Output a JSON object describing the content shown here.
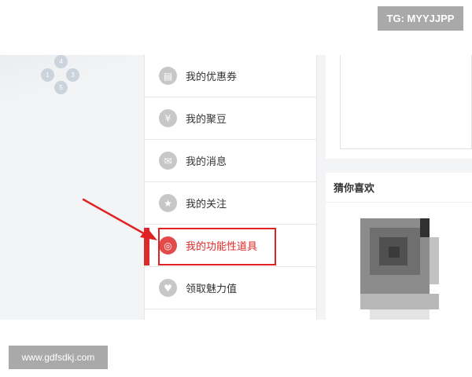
{
  "watermark_top": "TG: MYYJJPP",
  "watermark_bottom": "www.gdfsdkj.com",
  "dpad": {
    "labels": [
      "4",
      "1",
      "3",
      "5"
    ]
  },
  "menu": {
    "items": [
      {
        "label": "我的优惠券",
        "icon": "coupon-icon",
        "glyph": "▤"
      },
      {
        "label": "我的聚豆",
        "icon": "yen-icon",
        "glyph": "¥"
      },
      {
        "label": "我的消息",
        "icon": "envelope-icon",
        "glyph": "✉"
      },
      {
        "label": "我的关注",
        "icon": "star-icon",
        "glyph": "★"
      },
      {
        "label": "我的功能性道具",
        "icon": "target-icon",
        "glyph": "◎",
        "active": true
      },
      {
        "label": "领取魅力值",
        "icon": "heart-icon",
        "glyph": "♥"
      }
    ]
  },
  "guess_panel": {
    "title": "猜你喜欢"
  },
  "colors": {
    "accent": "#e02828",
    "icon_gray": "#c7c7c7",
    "annotation_red": "#e02222"
  }
}
